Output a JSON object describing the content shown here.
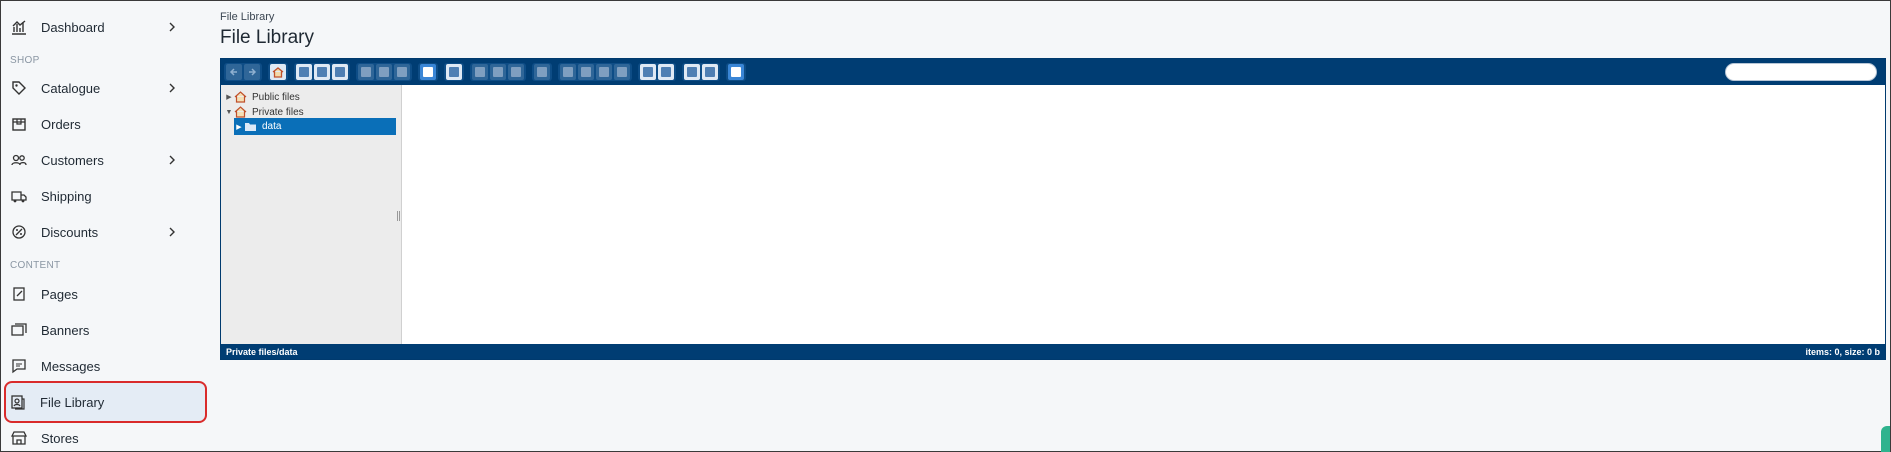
{
  "sidebar": {
    "items": [
      {
        "label": "Dashboard",
        "icon": "dashboard-icon",
        "chevron": true
      },
      {
        "label": "Catalogue",
        "icon": "tag-icon",
        "chevron": true
      },
      {
        "label": "Orders",
        "icon": "box-icon",
        "chevron": false
      },
      {
        "label": "Customers",
        "icon": "users-icon",
        "chevron": true
      },
      {
        "label": "Shipping",
        "icon": "truck-icon",
        "chevron": false
      },
      {
        "label": "Discounts",
        "icon": "discount-icon",
        "chevron": true
      },
      {
        "label": "Pages",
        "icon": "pages-icon",
        "chevron": false
      },
      {
        "label": "Banners",
        "icon": "banners-icon",
        "chevron": false
      },
      {
        "label": "Messages",
        "icon": "message-icon",
        "chevron": false
      },
      {
        "label": "File Library",
        "icon": "file-library-icon",
        "chevron": false,
        "active": true
      },
      {
        "label": "Stores",
        "icon": "store-icon",
        "chevron": false
      }
    ],
    "sections": {
      "shop": "SHOP",
      "content": "CONTENT"
    }
  },
  "main": {
    "breadcrumb": "File Library",
    "title": "File Library"
  },
  "file_manager": {
    "search_placeholder": "",
    "tree": [
      {
        "label": "Public files",
        "icon": "home-folder-icon",
        "expanded": false
      },
      {
        "label": "Private files",
        "icon": "home-folder-icon",
        "expanded": true
      },
      {
        "label": "data",
        "icon": "folder-icon",
        "selected": true
      }
    ],
    "status_path": "Private files/data",
    "status_info": "items: 0, size: 0 b"
  },
  "colors": {
    "toolbar_bg": "#003d73",
    "selected_folder": "#0a6fb8",
    "active_nav_outline": "#d92b2b"
  }
}
